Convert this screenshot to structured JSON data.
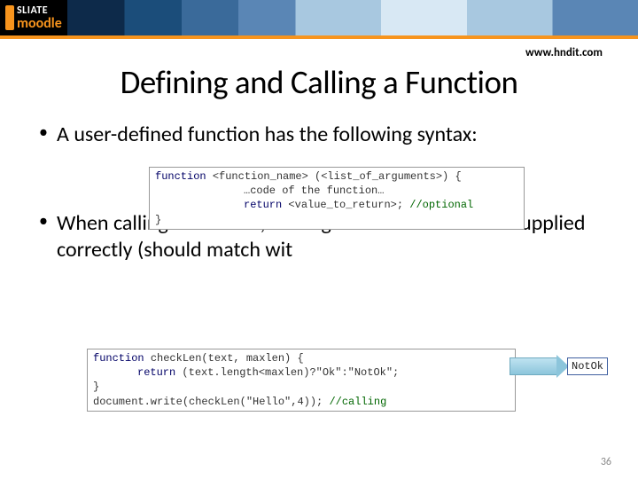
{
  "header": {
    "brand_top": "SLIATE",
    "brand_bottom": "moodle",
    "url": "www.hndit.com"
  },
  "slide": {
    "title": "Defining and Calling a Function",
    "bullets": [
      "A user-defined function has the following syntax:",
      "When calling a function, the argument list should be supplied correctly (should match wit"
    ],
    "code1": {
      "l1a": "function ",
      "l1b": "<function_name> (<list_of_arguments>) {",
      "l2": "…code of the function…",
      "l3a": "return ",
      "l3b": "<value_to_return>; ",
      "l3c": "//optional",
      "l4": "}"
    },
    "code2": {
      "l1a": "function ",
      "l1b": "checkLen(text, maxlen) {",
      "l2a": "return ",
      "l2b": "(text.length<maxlen)?\"Ok\":\"NotOk\";",
      "l3": "}",
      "l4a": "document.write(checkLen(\"Hello\",4)); ",
      "l4b": "//calling"
    },
    "result": "NotOk",
    "page_number": "36"
  }
}
